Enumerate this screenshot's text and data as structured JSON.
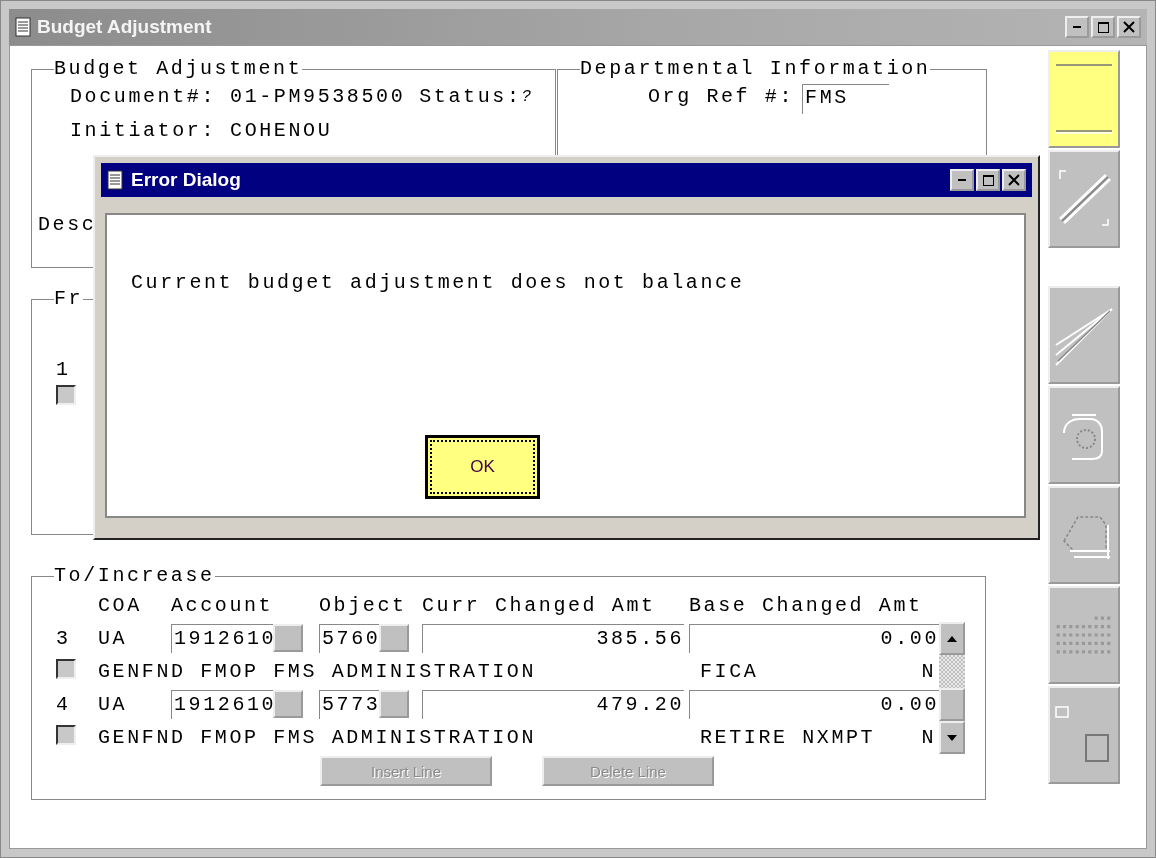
{
  "window": {
    "title": "Budget Adjustment"
  },
  "header_group": {
    "title": "Budget Adjustment",
    "document_label": "Document#:",
    "document": "01-PM9538500",
    "status_label": "Status:",
    "status": "?",
    "initiator_label": "Initiator:",
    "initiator": "COHENOU",
    "description_label": "Desc"
  },
  "departmental_group": {
    "title": "Departmental Information",
    "org_ref_label": "Org Ref #:",
    "org_ref": "FMS"
  },
  "from_group": {
    "title": "Fr",
    "rows": [
      {
        "number": "1",
        "checked": false
      }
    ]
  },
  "to_group": {
    "title": "To/Increase",
    "columns": [
      "COA",
      "Account",
      "Object",
      "Curr Changed Amt",
      "Base Changed Amt"
    ],
    "rows": [
      {
        "number": "3",
        "coa": "UA",
        "account": "1912610",
        "object": "5760",
        "curr_changed_amt": "385.56",
        "base_changed_amt": "0.00",
        "checked": false,
        "description": "GENFND FMOP FMS ADMINISTRATION",
        "category": "FICA",
        "flag": "N"
      },
      {
        "number": "4",
        "coa": "UA",
        "account": "1912610",
        "object": "5773",
        "curr_changed_amt": "479.20",
        "base_changed_amt": "0.00",
        "checked": false,
        "description": "GENFND FMOP FMS ADMINISTRATION",
        "category": "RETIRE NXMPT",
        "flag": "N"
      }
    ],
    "buttons": [
      {
        "label": "Insert Line",
        "disabled": true
      },
      {
        "label": "Delete Line",
        "disabled": true
      }
    ]
  },
  "toolbar": [
    {
      "kind": "line",
      "highlighted": true
    },
    {
      "kind": "cross",
      "highlighted": false
    },
    {
      "kind": "pen",
      "highlighted": false
    },
    {
      "kind": "phone",
      "highlighted": false
    },
    {
      "kind": "printer",
      "highlighted": false
    },
    {
      "kind": "grid",
      "highlighted": false
    },
    {
      "kind": "window",
      "highlighted": false
    }
  ],
  "dialog": {
    "title": "Error Dialog",
    "message": "Current budget adjustment does not balance",
    "button": "OK"
  }
}
